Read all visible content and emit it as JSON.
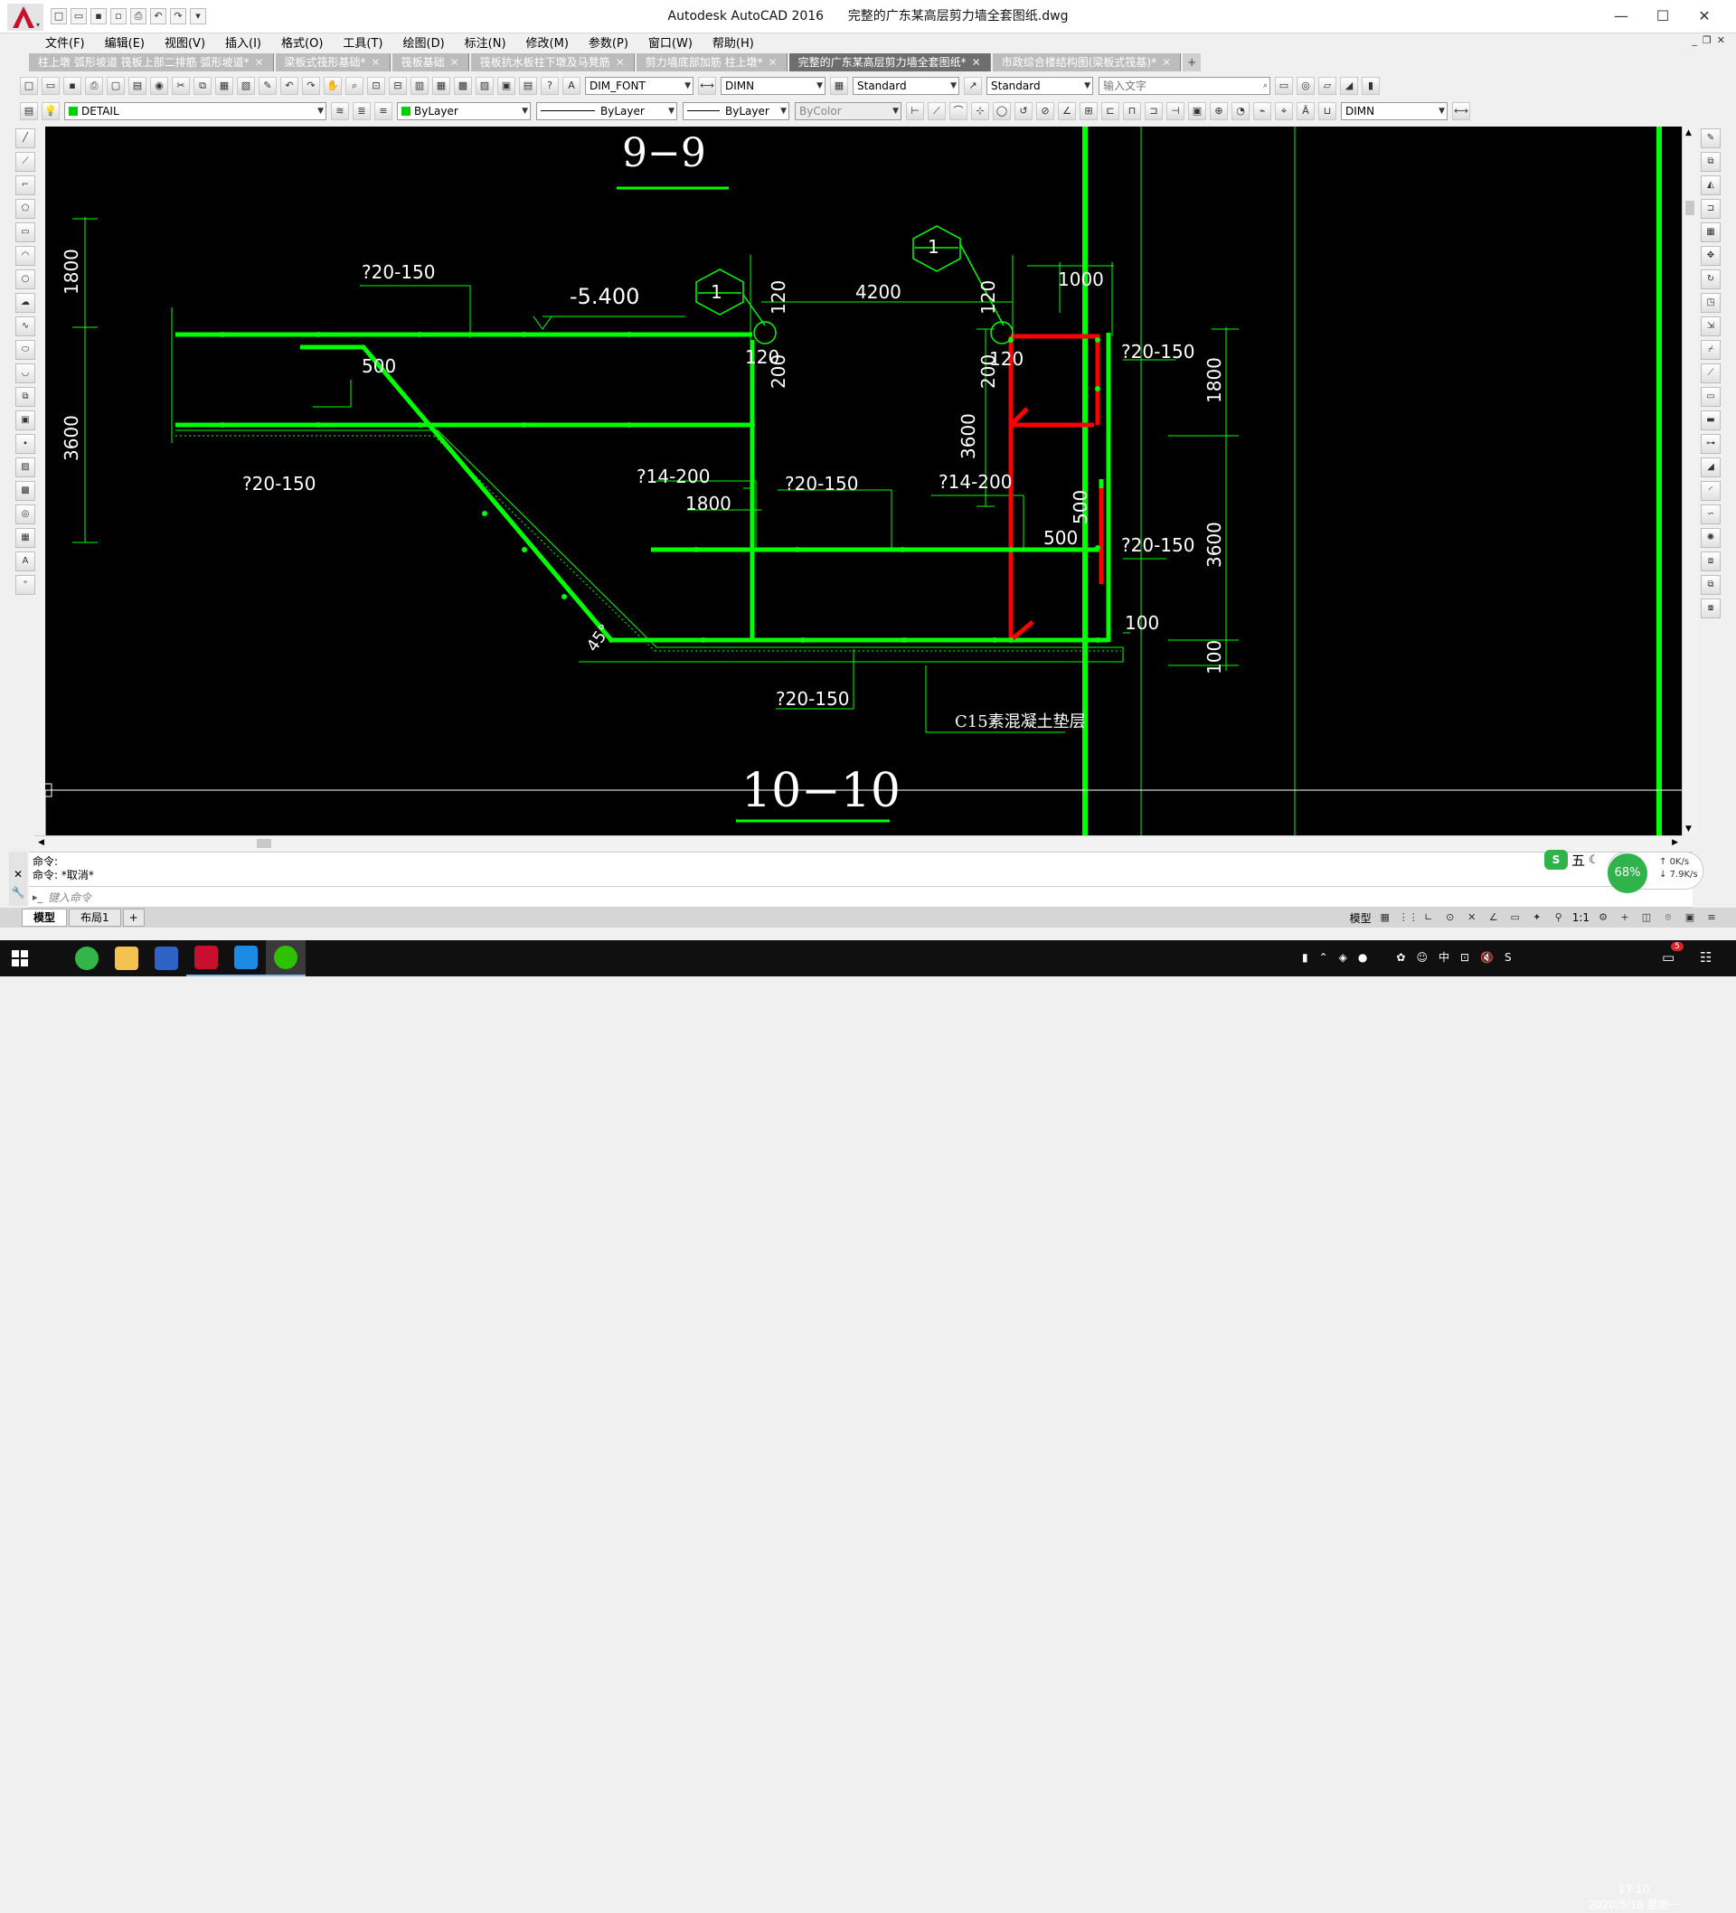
{
  "window": {
    "app_title": "Autodesk AutoCAD 2016",
    "document_title": "完整的广东某高层剪力墙全套图纸.dwg",
    "minimize": "—",
    "maximize": "☐",
    "close": "✕"
  },
  "menu": [
    "文件(F)",
    "编辑(E)",
    "视图(V)",
    "插入(I)",
    "格式(O)",
    "工具(T)",
    "绘图(D)",
    "标注(N)",
    "修改(M)",
    "参数(P)",
    "窗口(W)",
    "帮助(H)"
  ],
  "tabs": [
    {
      "label": "柱上墩 弧形坡道 筏板上部二排筋 弧形坡道*",
      "active": false
    },
    {
      "label": "梁板式筏形基础*",
      "active": false
    },
    {
      "label": "筏板基础",
      "active": false
    },
    {
      "label": "筏板抗水板柱下墩及马凳筋",
      "active": false
    },
    {
      "label": "剪力墙底部加筋 柱上墩*",
      "active": false
    },
    {
      "label": "完整的广东某高层剪力墙全套图纸*",
      "active": true
    },
    {
      "label": "市政综合楼结构图(梁板式筏基)*",
      "active": false
    }
  ],
  "toolbar1": {
    "text_style": "DIM_FONT",
    "dim_style": "DIMN",
    "table_style": "Standard",
    "mleader_style": "Standard",
    "search_placeholder": "输入文字"
  },
  "toolbar2": {
    "layer": "DETAIL",
    "color": "ByLayer",
    "linetype": "ByLayer",
    "lineweight": "ByLayer",
    "plotstyle": "ByColor",
    "dim_style": "DIMN"
  },
  "drawing": {
    "title_top": "9−9",
    "title_bottom": "10−10",
    "elevation": "-5.400",
    "detail_tag": "1",
    "dims": {
      "d1800_left": "1800",
      "d3600_left": "3600",
      "d500_top": "500",
      "d120_a": "120",
      "d120_b": "120",
      "d200_a": "200",
      "d4200": "4200",
      "d120_c": "120",
      "d120_d": "120",
      "d200_b": "200",
      "d1000": "1000",
      "d1800_right": "1800",
      "d3600_right": "3600",
      "d100_right": "100",
      "d100_bottom": "100",
      "d1800_mid": "1800",
      "d3600_mid": "3600",
      "d500_v": "500",
      "d500_h": "500",
      "angle45": "45°"
    },
    "rebar": {
      "r1": "?20-150",
      "r2": "?20-150",
      "r3": "?14-200",
      "r4": "?20-150",
      "r5": "?14-200",
      "r6": "?20-150",
      "r7": "?20-150",
      "r8": "?20-150"
    },
    "note": "C15素混凝土垫层"
  },
  "command": {
    "line1": "命令:",
    "line2": "命令: *取消*",
    "placeholder": "键入命令"
  },
  "model_tabs": [
    "模型",
    "布局1"
  ],
  "model_add": "+",
  "status": {
    "model_label": "模型",
    "scale": "1:1"
  },
  "ime": {
    "label": "五",
    "net_percent": "68%",
    "up": "0K/s",
    "down": "7.9K/s"
  },
  "taskbar": {
    "time": "17:10",
    "date": "2020/5/18 星期一",
    "notification_count": "5"
  },
  "colors": {
    "accent_green": "#00ff00",
    "red": "#ff0000",
    "canvas": "#000000"
  }
}
